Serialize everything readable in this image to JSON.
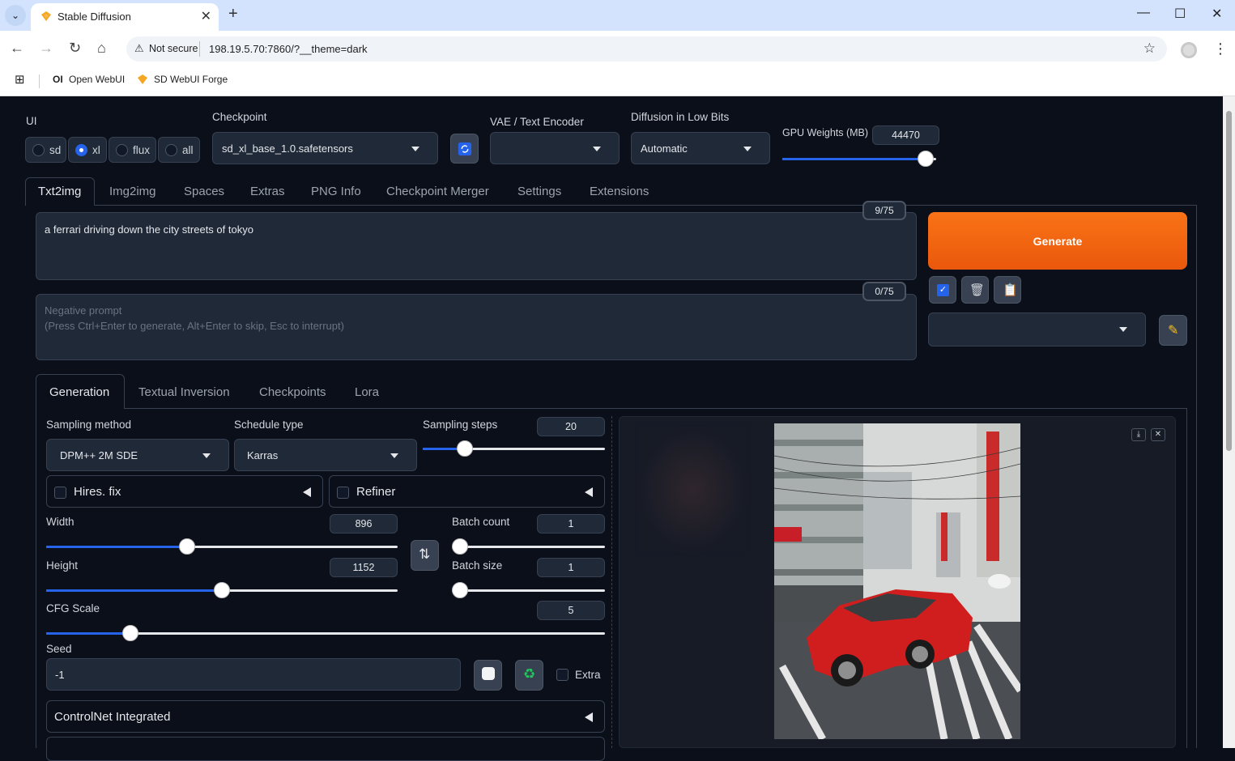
{
  "browser": {
    "tab_title": "Stable Diffusion",
    "not_secure": "Not secure",
    "url": "198.19.5.70:7860/?__theme=dark",
    "bookmarks": [
      "Open WebUI",
      "SD WebUI Forge"
    ]
  },
  "top": {
    "ui_label": "UI",
    "ui_options": [
      "sd",
      "xl",
      "flux",
      "all"
    ],
    "ui_selected": "xl",
    "checkpoint_label": "Checkpoint",
    "checkpoint_value": "sd_xl_base_1.0.safetensors",
    "vae_label": "VAE / Text Encoder",
    "vae_value": "",
    "diffusion_label": "Diffusion in Low Bits",
    "diffusion_value": "Automatic",
    "gpu_label": "GPU Weights (MB)",
    "gpu_value": "44470",
    "gpu_level": 0.93
  },
  "main_tabs": [
    "Txt2img",
    "Img2img",
    "Spaces",
    "Extras",
    "PNG Info",
    "Checkpoint Merger",
    "Settings",
    "Extensions"
  ],
  "main_tab_active": "Txt2img",
  "prompt": {
    "text": "a ferrari driving down the city streets of tokyo",
    "counter": "9/75",
    "negative_placeholder_1": "Negative prompt",
    "negative_placeholder_2": "(Press Ctrl+Enter to generate, Alt+Enter to skip, Esc to interrupt)",
    "negative_counter": "0/75"
  },
  "generate_label": "Generate",
  "sub_tabs": [
    "Generation",
    "Textual Inversion",
    "Checkpoints",
    "Lora"
  ],
  "generation": {
    "sampling_method_label": "Sampling method",
    "sampling_method": "DPM++ 2M SDE",
    "schedule_label": "Schedule type",
    "schedule": "Karras",
    "steps_label": "Sampling steps",
    "steps": "20",
    "steps_level": 0.23,
    "hires_label": "Hires. fix",
    "refiner_label": "Refiner",
    "width_label": "Width",
    "width": "896",
    "width_level": 0.4,
    "height_label": "Height",
    "height": "1152",
    "height_level": 0.5,
    "batch_count_label": "Batch count",
    "batch_count": "1",
    "batch_size_label": "Batch size",
    "batch_size": "1",
    "cfg_label": "CFG Scale",
    "cfg": "5",
    "cfg_level": 0.15,
    "seed_label": "Seed",
    "seed": "-1",
    "extra_label": "Extra",
    "controlnet_label": "ControlNet Integrated"
  }
}
